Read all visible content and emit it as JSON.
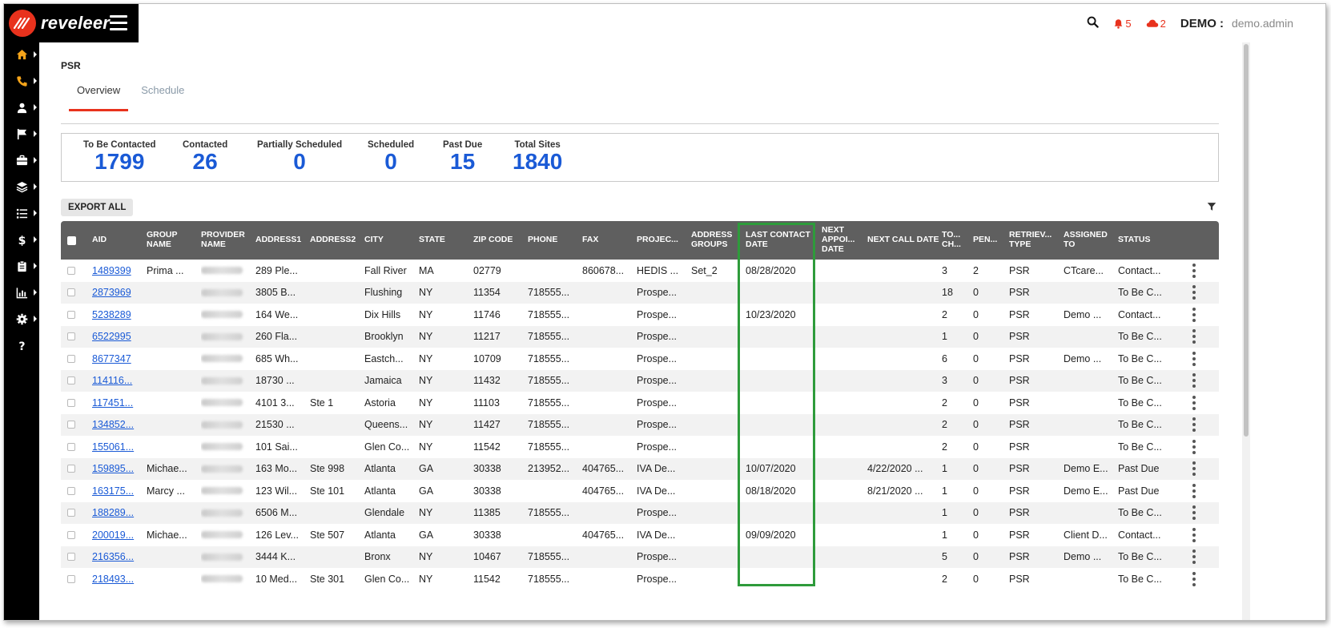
{
  "app": {
    "logo_text": "reveleer",
    "brand_color": "#e8321d",
    "accent_color": "#1a5ad6",
    "highlight_color": "#2e9b3b"
  },
  "header": {
    "search_icon": "search-icon",
    "bell_count": "5",
    "cloud_count": "2",
    "user_label": "DEMO :",
    "user_name": "demo.admin"
  },
  "nav": {
    "items": [
      "home-icon",
      "phone-icon",
      "users-icon",
      "flag-icon",
      "briefcase-icon",
      "layers-icon",
      "list-icon",
      "dollar-icon",
      "clipboard-icon",
      "chart-icon",
      "gear-icon",
      "help-icon"
    ]
  },
  "page": {
    "breadcrumb": "PSR"
  },
  "tabs": [
    {
      "label": "Overview",
      "active": true
    },
    {
      "label": "Schedule",
      "active": false
    }
  ],
  "stats": [
    {
      "label": "To Be Contacted",
      "value": "1799"
    },
    {
      "label": "Contacted",
      "value": "26"
    },
    {
      "label": "Partially Scheduled",
      "value": "0"
    },
    {
      "label": "Scheduled",
      "value": "0"
    },
    {
      "label": "Past Due",
      "value": "15"
    },
    {
      "label": "Total Sites",
      "value": "1840"
    }
  ],
  "toolbar": {
    "export_label": "EXPORT ALL"
  },
  "columns": [
    {
      "key": "aid",
      "label": "AID"
    },
    {
      "key": "group",
      "label": "GROUP NAME"
    },
    {
      "key": "provider",
      "label": "PROVIDER NAME"
    },
    {
      "key": "address1",
      "label": "ADDRESS1"
    },
    {
      "key": "address2",
      "label": "ADDRESS2"
    },
    {
      "key": "city",
      "label": "CITY"
    },
    {
      "key": "state",
      "label": "STATE"
    },
    {
      "key": "zip",
      "label": "ZIP CODE"
    },
    {
      "key": "phone",
      "label": "PHONE"
    },
    {
      "key": "fax",
      "label": "FAX"
    },
    {
      "key": "project",
      "label": "PROJEC..."
    },
    {
      "key": "address_groups",
      "label": "ADDRESS GROUPS"
    },
    {
      "key": "last_contact",
      "label": "LAST CONTACT DATE"
    },
    {
      "key": "next_appt",
      "label": "NEXT APPOI... DATE"
    },
    {
      "key": "next_call",
      "label": "NEXT CALL DATE"
    },
    {
      "key": "to_ch",
      "label": "TO... CH..."
    },
    {
      "key": "pen",
      "label": "PEN..."
    },
    {
      "key": "retrieval",
      "label": "RETRIEV... TYPE"
    },
    {
      "key": "assigned",
      "label": "ASSIGNED TO"
    },
    {
      "key": "status",
      "label": "STATUS"
    }
  ],
  "rows": [
    {
      "aid": "1489399",
      "group": "Prima ...",
      "address1": "289 Ple...",
      "address2": "",
      "city": "Fall River",
      "state": "MA",
      "zip": "02779",
      "phone": "",
      "fax": "860678...",
      "project": "HEDIS ...",
      "address_groups": "Set_2",
      "last_contact": "08/28/2020",
      "next_appt": "",
      "next_call": "",
      "to_ch": "3",
      "pen": "2",
      "retrieval": "PSR",
      "assigned": "CTcare...",
      "status": "Contact..."
    },
    {
      "aid": "2873969",
      "group": "",
      "address1": "3805 B...",
      "address2": "",
      "city": "Flushing",
      "state": "NY",
      "zip": "11354",
      "phone": "718555...",
      "fax": "",
      "project": "Prospe...",
      "address_groups": "",
      "last_contact": "",
      "next_appt": "",
      "next_call": "",
      "to_ch": "18",
      "pen": "0",
      "retrieval": "PSR",
      "assigned": "",
      "status": "To Be C..."
    },
    {
      "aid": "5238289",
      "group": "",
      "address1": "164 We...",
      "address2": "",
      "city": "Dix Hills",
      "state": "NY",
      "zip": "11746",
      "phone": "718555...",
      "fax": "",
      "project": "Prospe...",
      "address_groups": "",
      "last_contact": "10/23/2020",
      "next_appt": "",
      "next_call": "",
      "to_ch": "2",
      "pen": "0",
      "retrieval": "PSR",
      "assigned": "Demo ...",
      "status": "Contact..."
    },
    {
      "aid": "6522995",
      "group": "",
      "address1": "260 Fla...",
      "address2": "",
      "city": "Brooklyn",
      "state": "NY",
      "zip": "11217",
      "phone": "718555...",
      "fax": "",
      "project": "Prospe...",
      "address_groups": "",
      "last_contact": "",
      "next_appt": "",
      "next_call": "",
      "to_ch": "1",
      "pen": "0",
      "retrieval": "PSR",
      "assigned": "",
      "status": "To Be C..."
    },
    {
      "aid": "8677347",
      "group": "",
      "address1": "685 Wh...",
      "address2": "",
      "city": "Eastch...",
      "state": "NY",
      "zip": "10709",
      "phone": "718555...",
      "fax": "",
      "project": "Prospe...",
      "address_groups": "",
      "last_contact": "",
      "next_appt": "",
      "next_call": "",
      "to_ch": "6",
      "pen": "0",
      "retrieval": "PSR",
      "assigned": "Demo ...",
      "status": "To Be C..."
    },
    {
      "aid": "114116...",
      "group": "",
      "address1": "18730 ...",
      "address2": "",
      "city": "Jamaica",
      "state": "NY",
      "zip": "11432",
      "phone": "718555...",
      "fax": "",
      "project": "Prospe...",
      "address_groups": "",
      "last_contact": "",
      "next_appt": "",
      "next_call": "",
      "to_ch": "3",
      "pen": "0",
      "retrieval": "PSR",
      "assigned": "",
      "status": "To Be C..."
    },
    {
      "aid": "117451...",
      "group": "",
      "address1": "4101 3...",
      "address2": "Ste 1",
      "city": "Astoria",
      "state": "NY",
      "zip": "11103",
      "phone": "718555...",
      "fax": "",
      "project": "Prospe...",
      "address_groups": "",
      "last_contact": "",
      "next_appt": "",
      "next_call": "",
      "to_ch": "2",
      "pen": "0",
      "retrieval": "PSR",
      "assigned": "",
      "status": "To Be C..."
    },
    {
      "aid": "134852...",
      "group": "",
      "address1": "21530 ...",
      "address2": "",
      "city": "Queens...",
      "state": "NY",
      "zip": "11427",
      "phone": "718555...",
      "fax": "",
      "project": "Prospe...",
      "address_groups": "",
      "last_contact": "",
      "next_appt": "",
      "next_call": "",
      "to_ch": "2",
      "pen": "0",
      "retrieval": "PSR",
      "assigned": "",
      "status": "To Be C..."
    },
    {
      "aid": "155061...",
      "group": "",
      "address1": "101 Sai...",
      "address2": "",
      "city": "Glen Co...",
      "state": "NY",
      "zip": "11542",
      "phone": "718555...",
      "fax": "",
      "project": "Prospe...",
      "address_groups": "",
      "last_contact": "",
      "next_appt": "",
      "next_call": "",
      "to_ch": "2",
      "pen": "0",
      "retrieval": "PSR",
      "assigned": "",
      "status": "To Be C..."
    },
    {
      "aid": "159895...",
      "group": "Michae...",
      "address1": "163 Mo...",
      "address2": "Ste 998",
      "city": "Atlanta",
      "state": "GA",
      "zip": "30338",
      "phone": "213952...",
      "fax": "404765...",
      "project": "IVA De...",
      "address_groups": "",
      "last_contact": "10/07/2020",
      "next_appt": "",
      "next_call": "4/22/2020 ...",
      "to_ch": "1",
      "pen": "0",
      "retrieval": "PSR",
      "assigned": "Demo E...",
      "status": "Past Due"
    },
    {
      "aid": "163175...",
      "group": "Marcy ...",
      "address1": "123 Wil...",
      "address2": "Ste 101",
      "city": "Atlanta",
      "state": "GA",
      "zip": "30338",
      "phone": "",
      "fax": "404765...",
      "project": "IVA De...",
      "address_groups": "",
      "last_contact": "08/18/2020",
      "next_appt": "",
      "next_call": "8/21/2020 ...",
      "to_ch": "1",
      "pen": "0",
      "retrieval": "PSR",
      "assigned": "Demo E...",
      "status": "Past Due"
    },
    {
      "aid": "188289...",
      "group": "",
      "address1": "6506 M...",
      "address2": "",
      "city": "Glendale",
      "state": "NY",
      "zip": "11385",
      "phone": "718555...",
      "fax": "",
      "project": "Prospe...",
      "address_groups": "",
      "last_contact": "",
      "next_appt": "",
      "next_call": "",
      "to_ch": "1",
      "pen": "0",
      "retrieval": "PSR",
      "assigned": "",
      "status": "To Be C..."
    },
    {
      "aid": "200019...",
      "group": "Michae...",
      "address1": "126 Lev...",
      "address2": "Ste 507",
      "city": "Atlanta",
      "state": "GA",
      "zip": "30338",
      "phone": "",
      "fax": "404765...",
      "project": "IVA De...",
      "address_groups": "",
      "last_contact": "09/09/2020",
      "next_appt": "",
      "next_call": "",
      "to_ch": "1",
      "pen": "0",
      "retrieval": "PSR",
      "assigned": "Client D...",
      "status": "Contact..."
    },
    {
      "aid": "216356...",
      "group": "",
      "address1": "3444 K...",
      "address2": "",
      "city": "Bronx",
      "state": "NY",
      "zip": "10467",
      "phone": "718555...",
      "fax": "",
      "project": "Prospe...",
      "address_groups": "",
      "last_contact": "",
      "next_appt": "",
      "next_call": "",
      "to_ch": "5",
      "pen": "0",
      "retrieval": "PSR",
      "assigned": "Demo ...",
      "status": "To Be C..."
    },
    {
      "aid": "218493...",
      "group": "",
      "address1": "10 Med...",
      "address2": "Ste 301",
      "city": "Glen Co...",
      "state": "NY",
      "zip": "11542",
      "phone": "718555...",
      "fax": "",
      "project": "Prospe...",
      "address_groups": "",
      "last_contact": "",
      "next_appt": "",
      "next_call": "",
      "to_ch": "2",
      "pen": "0",
      "retrieval": "PSR",
      "assigned": "",
      "status": "To Be C..."
    }
  ]
}
